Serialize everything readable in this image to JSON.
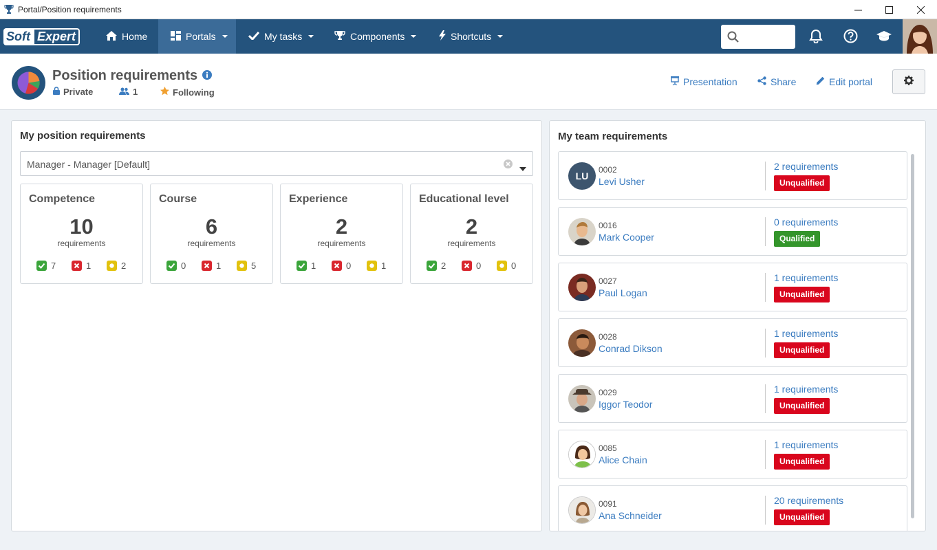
{
  "window": {
    "title": "Portal/Position requirements"
  },
  "navbar": {
    "logo": {
      "part1": "Soft",
      "part2": "Expert"
    },
    "items": [
      {
        "label": "Home",
        "icon": "home-icon"
      },
      {
        "label": "Portals",
        "icon": "portals-icon",
        "active": true
      },
      {
        "label": "My tasks",
        "icon": "check-icon"
      },
      {
        "label": "Components",
        "icon": "trophy-icon"
      },
      {
        "label": "Shortcuts",
        "icon": "bolt-icon"
      }
    ],
    "search": {
      "placeholder": ""
    },
    "colors": {
      "bar": "#24537d",
      "active": "#3b6b98"
    }
  },
  "header": {
    "title": "Position requirements",
    "privacy": "Private",
    "members_count": "1",
    "following": "Following",
    "actions": {
      "presentation": "Presentation",
      "share": "Share",
      "edit": "Edit portal"
    }
  },
  "left_panel": {
    "title": "My position requirements",
    "select_value": "Manager - Manager [Default]",
    "cards": [
      {
        "title": "Competence",
        "count": "10",
        "label": "requirements",
        "met": "7",
        "unmet": "1",
        "pending": "2"
      },
      {
        "title": "Course",
        "count": "6",
        "label": "requirements",
        "met": "0",
        "unmet": "1",
        "pending": "5"
      },
      {
        "title": "Experience",
        "count": "2",
        "label": "requirements",
        "met": "1",
        "unmet": "0",
        "pending": "1"
      },
      {
        "title": "Educational level",
        "count": "2",
        "label": "requirements",
        "met": "2",
        "unmet": "0",
        "pending": "0"
      }
    ]
  },
  "right_panel": {
    "title": "My team requirements",
    "members": [
      {
        "code": "0002",
        "name": "Levi Usher",
        "initials": "LU",
        "requirements": "2 requirements",
        "status": "Unqualified"
      },
      {
        "code": "0016",
        "name": "Mark Cooper",
        "requirements": "0 requirements",
        "status": "Qualified"
      },
      {
        "code": "0027",
        "name": "Paul Logan",
        "requirements": "1 requirements",
        "status": "Unqualified"
      },
      {
        "code": "0028",
        "name": "Conrad Dikson",
        "requirements": "1 requirements",
        "status": "Unqualified"
      },
      {
        "code": "0029",
        "name": "Iggor Teodor",
        "requirements": "1 requirements",
        "status": "Unqualified"
      },
      {
        "code": "0085",
        "name": "Alice Chain",
        "requirements": "1 requirements",
        "status": "Unqualified"
      },
      {
        "code": "0091",
        "name": "Ana Schneider",
        "requirements": "20 requirements",
        "status": "Unqualified"
      }
    ]
  }
}
